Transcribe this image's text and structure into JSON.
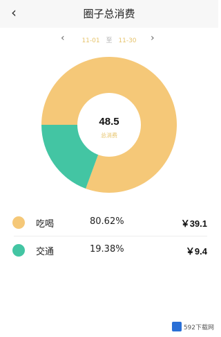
{
  "header": {
    "back_icon": "chevron-left-icon",
    "title": "圈子总消费"
  },
  "date_range": {
    "prev_icon": "chevron-left-icon",
    "next_icon": "chevron-right-icon",
    "start": "11-01",
    "separator": "至",
    "end": "11-30"
  },
  "summary": {
    "total": "48.5",
    "total_label": "总消费"
  },
  "colors": {
    "food": "#f5c878",
    "transport": "#43c5a3"
  },
  "chart_data": {
    "type": "pie",
    "categories": [
      "吃喝",
      "交通"
    ],
    "values": [
      80.62,
      19.38
    ],
    "amounts": [
      39.1,
      9.4
    ],
    "title": "",
    "colors": [
      "#f5c878",
      "#43c5a3"
    ]
  },
  "categories": [
    {
      "name": "吃喝",
      "percent": "80.62%",
      "amount": "￥39.1"
    },
    {
      "name": "交通",
      "percent": "19.38%",
      "amount": "￥9.4"
    }
  ],
  "watermark": {
    "text": "592下载网"
  }
}
